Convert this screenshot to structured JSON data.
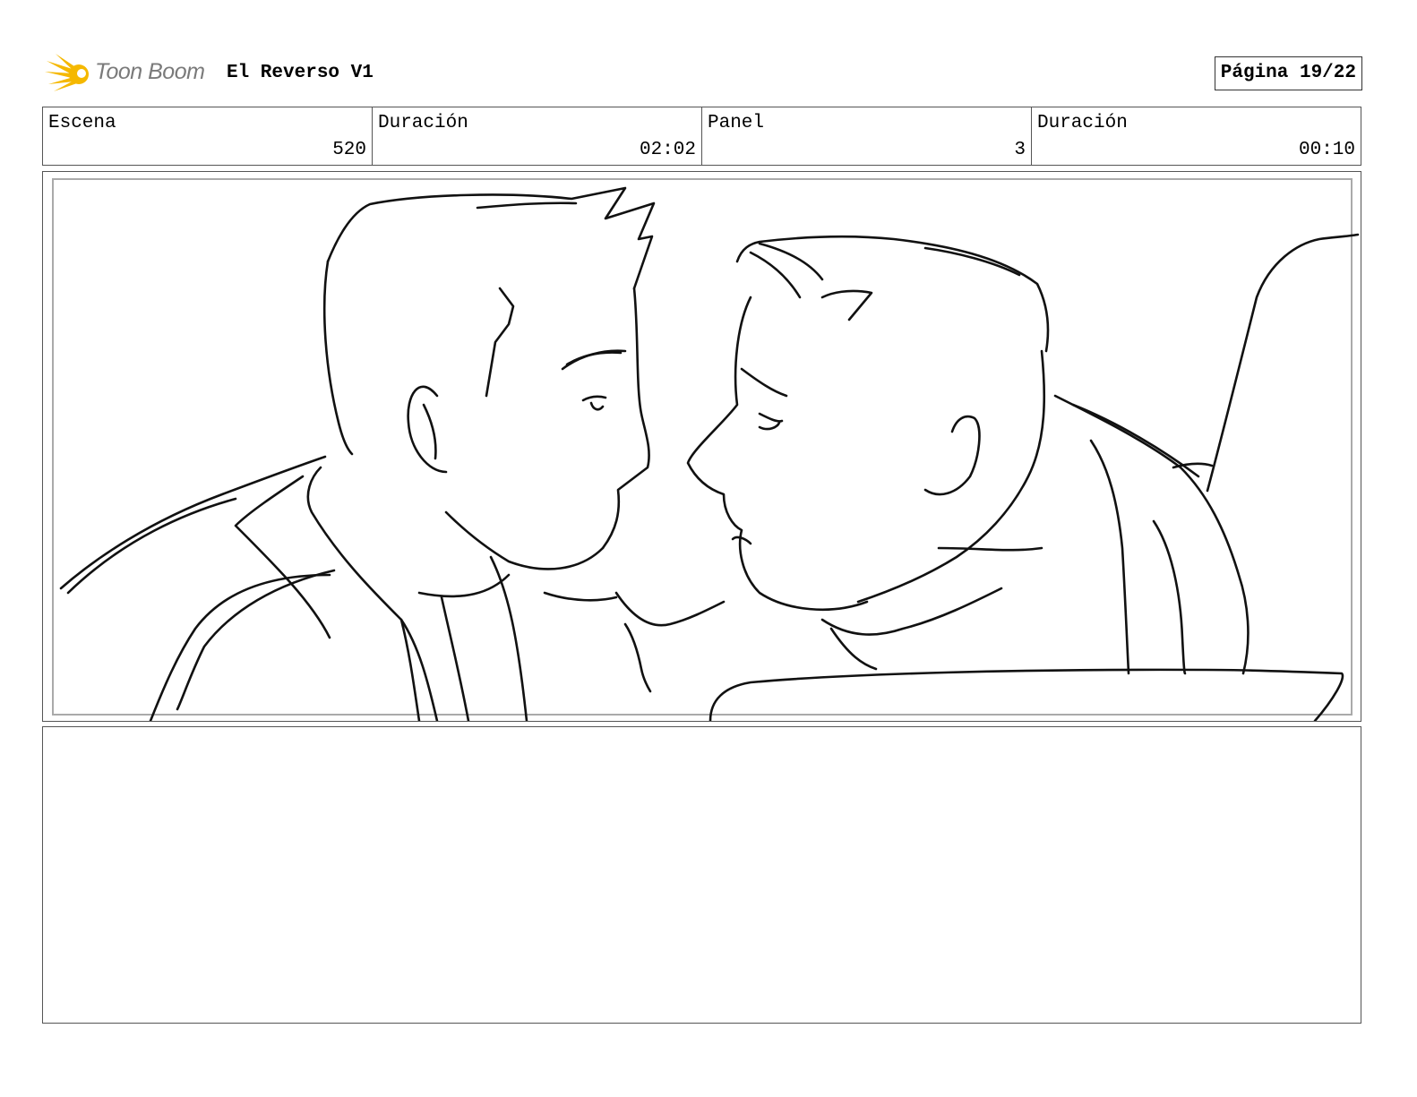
{
  "header": {
    "logo_text": "Toon Boom",
    "project_title": "El Reverso V1",
    "page_label": "Página 19/22"
  },
  "info": [
    {
      "label": "Escena",
      "value": "520"
    },
    {
      "label": "Duración",
      "value": "02:02"
    },
    {
      "label": "Panel",
      "value": "3"
    },
    {
      "label": "Duración",
      "value": "00:10"
    }
  ],
  "panel": {
    "icon": "storyboard-sketch-image",
    "notes": ""
  },
  "colors": {
    "logo_yellow": "#f5b800",
    "logo_text": "#7a7a7a",
    "border": "#555555"
  }
}
